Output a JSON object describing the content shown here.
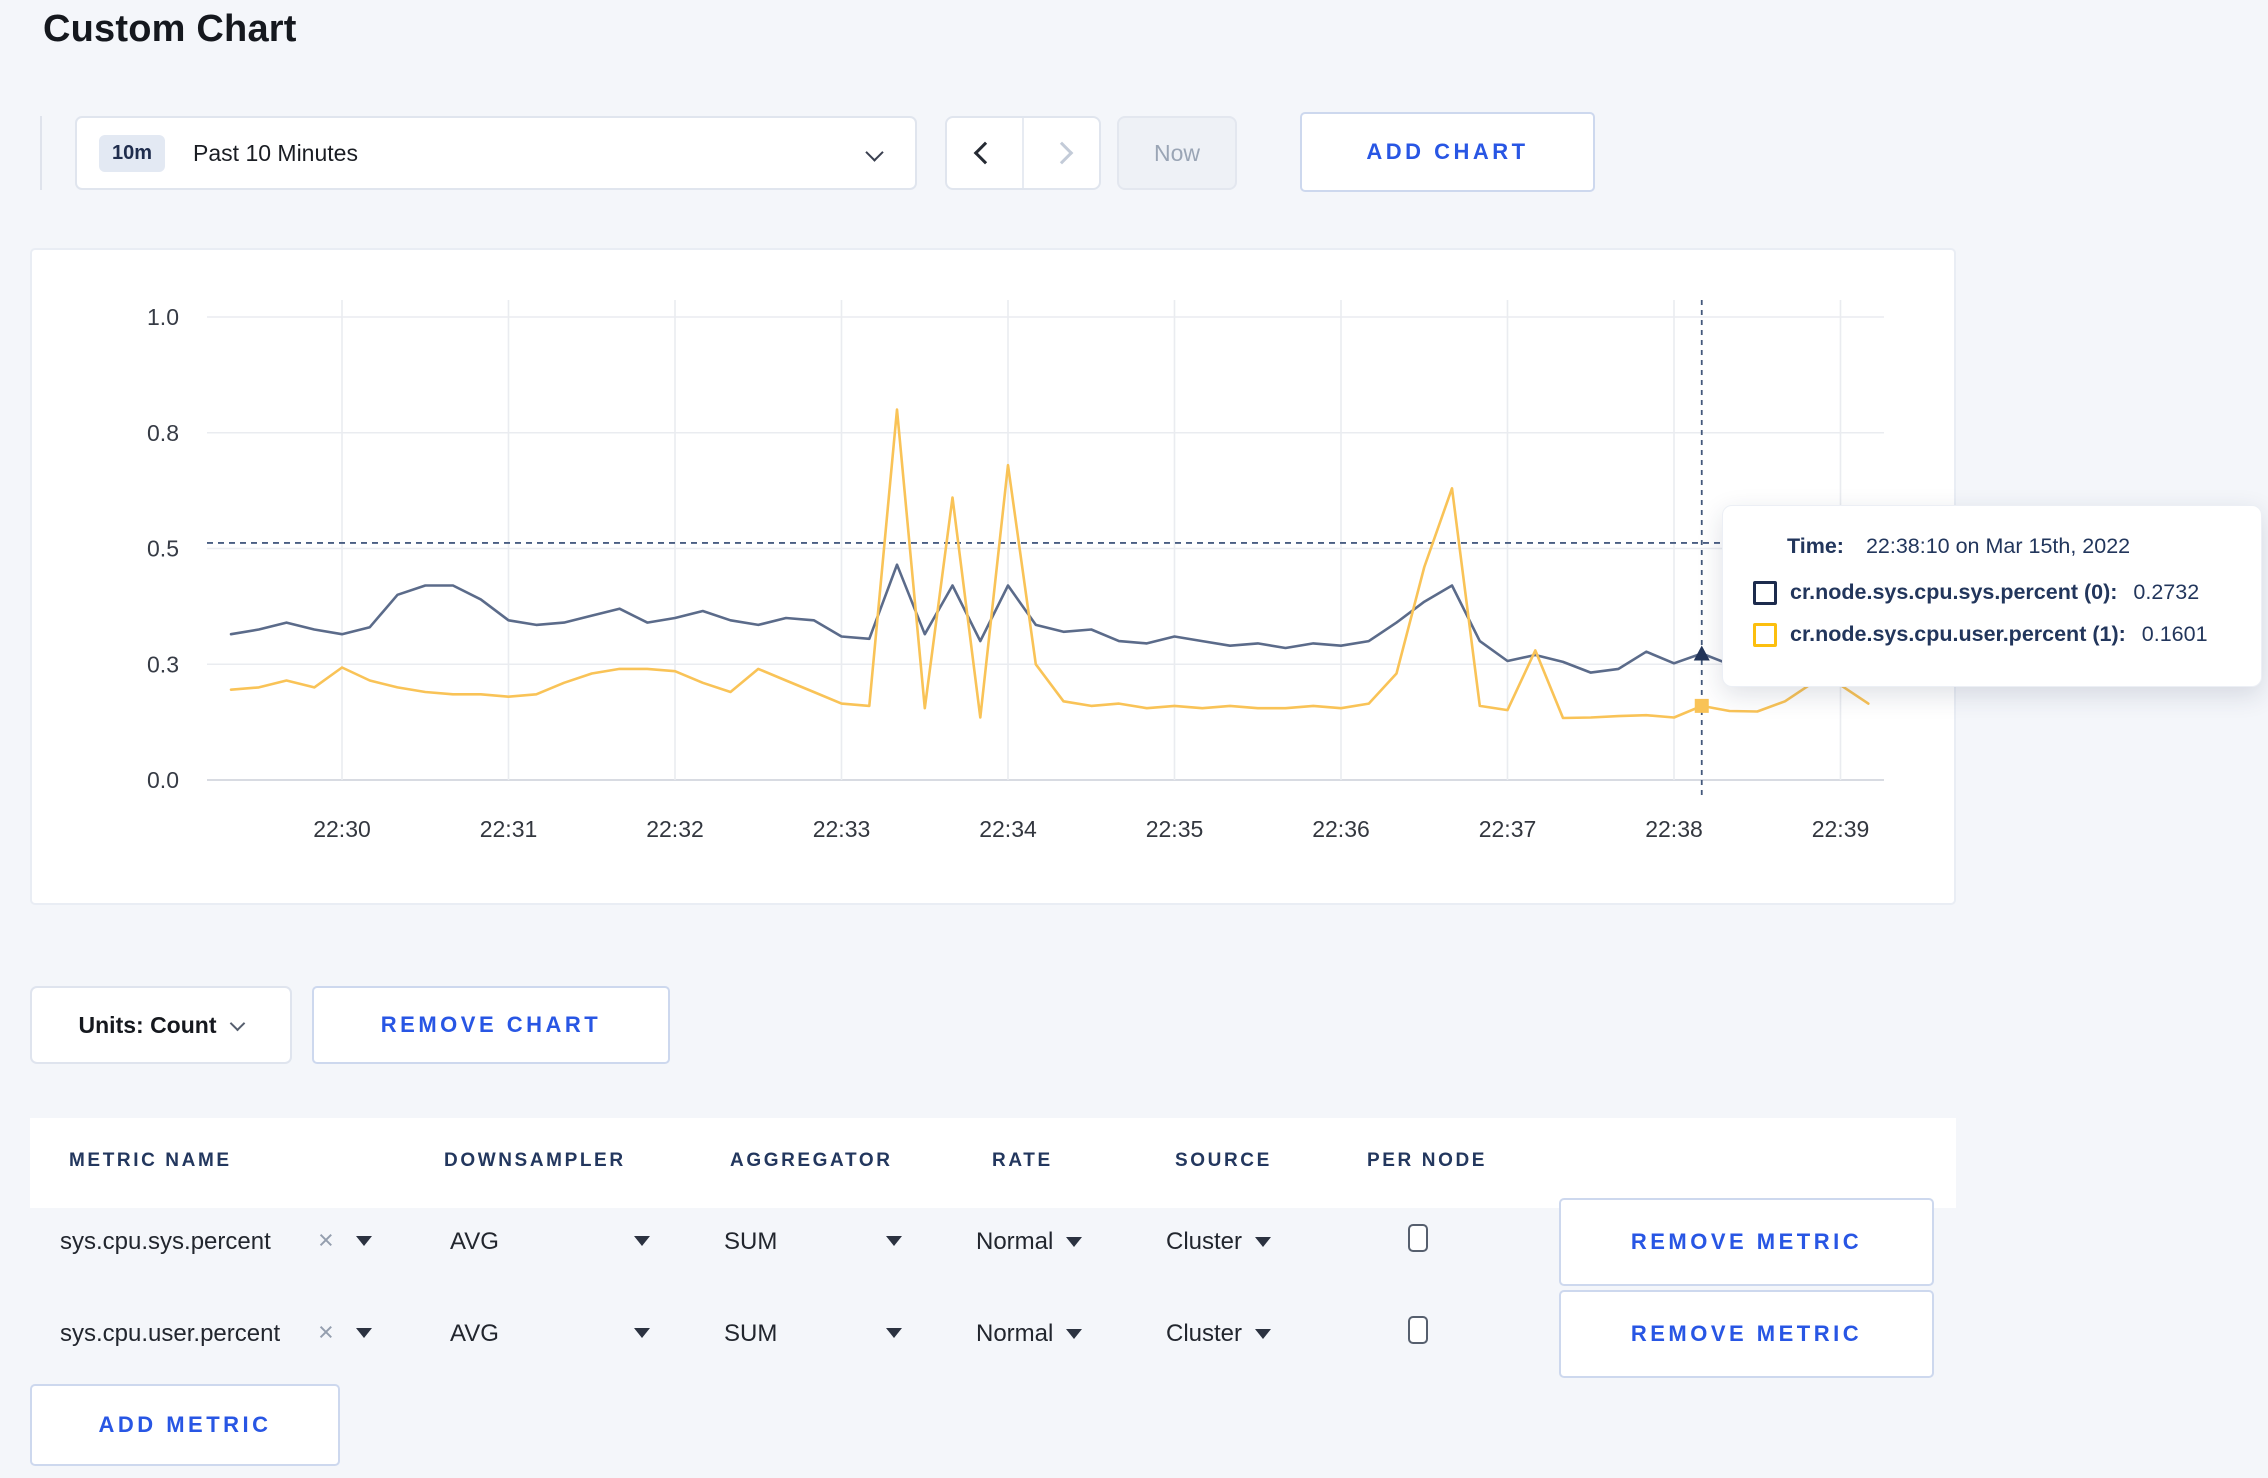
{
  "page": {
    "title": "Custom Chart"
  },
  "toolbar": {
    "time_badge": "10m",
    "time_label": "Past 10 Minutes",
    "now_label": "Now",
    "add_chart_label": "ADD CHART"
  },
  "chart_controls": {
    "units_label": "Units: Count",
    "remove_chart_label": "REMOVE CHART",
    "add_metric_label": "ADD METRIC"
  },
  "tooltip": {
    "time_label": "Time:",
    "time_value": "22:38:10 on Mar 15th, 2022",
    "series": [
      {
        "name": "cr.node.sys.cpu.sys.percent (0):",
        "value": "0.2732",
        "color": "#1c2b4d"
      },
      {
        "name": "cr.node.sys.cpu.user.percent (1):",
        "value": "0.1601",
        "color": "#fcbf0f"
      }
    ]
  },
  "metrics_table": {
    "headers": [
      "METRIC NAME",
      "DOWNSAMPLER",
      "AGGREGATOR",
      "RATE",
      "SOURCE",
      "PER NODE"
    ],
    "rows": [
      {
        "metric": "sys.cpu.sys.percent",
        "downsampler": "AVG",
        "aggregator": "SUM",
        "rate": "Normal",
        "source": "Cluster",
        "per_node_checked": false,
        "remove_label": "REMOVE METRIC"
      },
      {
        "metric": "sys.cpu.user.percent",
        "downsampler": "AVG",
        "aggregator": "SUM",
        "rate": "Normal",
        "source": "Cluster",
        "per_node_checked": false,
        "remove_label": "REMOVE METRIC"
      }
    ]
  },
  "chart_data": {
    "type": "line",
    "title": "",
    "xlabel": "",
    "ylabel": "",
    "ylim": [
      0,
      1.0
    ],
    "grid": true,
    "legend_position": "tooltip",
    "y_tick_values": [
      0,
      0.25,
      0.5,
      0.75,
      1.0
    ],
    "y_tick_labels": [
      "0.0",
      "0.3",
      "0.5",
      "0.8",
      "1.0"
    ],
    "x_ticks": [
      "22:30",
      "22:31",
      "22:32",
      "22:33",
      "22:34",
      "22:35",
      "22:36",
      "22:37",
      "22:38",
      "22:39"
    ],
    "hover_time": "22:38:10",
    "hover_line_value": 0.512,
    "times": [
      "22:29:20",
      "22:29:30",
      "22:29:40",
      "22:29:50",
      "22:30:00",
      "22:30:10",
      "22:30:20",
      "22:30:30",
      "22:30:40",
      "22:30:50",
      "22:31:00",
      "22:31:10",
      "22:31:20",
      "22:31:30",
      "22:31:40",
      "22:31:50",
      "22:32:00",
      "22:32:10",
      "22:32:20",
      "22:32:30",
      "22:32:40",
      "22:32:50",
      "22:33:00",
      "22:33:10",
      "22:33:20",
      "22:33:30",
      "22:33:40",
      "22:33:50",
      "22:34:00",
      "22:34:10",
      "22:34:20",
      "22:34:30",
      "22:34:40",
      "22:34:50",
      "22:35:00",
      "22:35:10",
      "22:35:20",
      "22:35:30",
      "22:35:40",
      "22:35:50",
      "22:36:00",
      "22:36:10",
      "22:36:20",
      "22:36:30",
      "22:36:40",
      "22:36:50",
      "22:37:00",
      "22:37:10",
      "22:37:20",
      "22:37:30",
      "22:37:40",
      "22:37:50",
      "22:38:00",
      "22:38:10",
      "22:38:20",
      "22:38:30",
      "22:38:40",
      "22:38:50",
      "22:39:00",
      "22:39:10"
    ],
    "series": [
      {
        "name": "cr.node.sys.cpu.sys.percent",
        "color": "#5b6b8a",
        "marker": "triangle",
        "hover_value": 0.2732,
        "values": [
          0.315,
          0.325,
          0.34,
          0.325,
          0.315,
          0.33,
          0.4,
          0.42,
          0.42,
          0.39,
          0.345,
          0.335,
          0.34,
          0.355,
          0.37,
          0.34,
          0.35,
          0.365,
          0.345,
          0.335,
          0.35,
          0.345,
          0.31,
          0.305,
          0.465,
          0.315,
          0.42,
          0.3,
          0.42,
          0.335,
          0.32,
          0.325,
          0.3,
          0.295,
          0.31,
          0.3,
          0.29,
          0.295,
          0.285,
          0.295,
          0.29,
          0.3,
          0.34,
          0.385,
          0.42,
          0.3,
          0.257,
          0.27,
          0.255,
          0.232,
          0.24,
          0.277,
          0.252,
          0.2732,
          0.25,
          0.255,
          0.25,
          0.25,
          0.25,
          0.25
        ]
      },
      {
        "name": "cr.node.sys.cpu.user.percent",
        "color": "#f9c357",
        "marker": "square",
        "hover_value": 0.1601,
        "values": [
          0.195,
          0.2,
          0.215,
          0.2,
          0.243,
          0.215,
          0.2,
          0.19,
          0.185,
          0.185,
          0.18,
          0.185,
          0.21,
          0.23,
          0.24,
          0.24,
          0.235,
          0.21,
          0.19,
          0.24,
          0.215,
          0.19,
          0.165,
          0.16,
          0.8,
          0.155,
          0.61,
          0.135,
          0.68,
          0.25,
          0.17,
          0.16,
          0.165,
          0.155,
          0.16,
          0.155,
          0.16,
          0.155,
          0.155,
          0.16,
          0.155,
          0.165,
          0.23,
          0.46,
          0.63,
          0.16,
          0.151,
          0.28,
          0.134,
          0.135,
          0.138,
          0.14,
          0.135,
          0.1601,
          0.149,
          0.148,
          0.17,
          0.21,
          0.205,
          0.165
        ]
      }
    ]
  }
}
